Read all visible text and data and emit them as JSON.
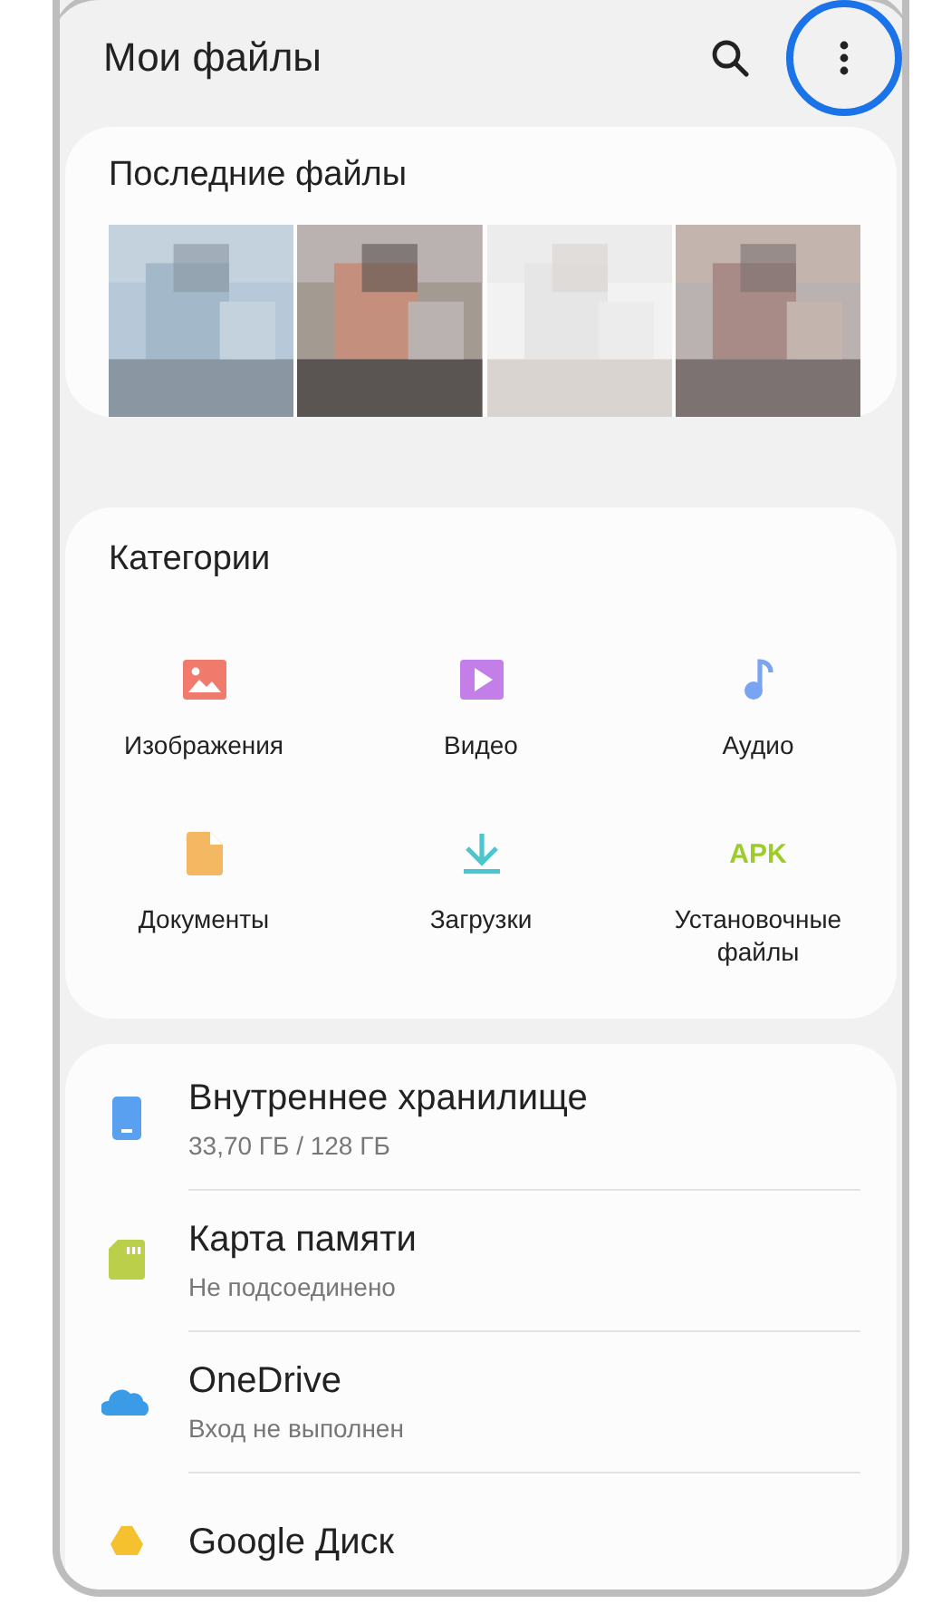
{
  "app_bar": {
    "title": "Мои файлы",
    "menu_highlighted": true
  },
  "recent": {
    "title": "Последние файлы"
  },
  "categories": {
    "title": "Категории",
    "items": [
      {
        "label": "Изображения",
        "kind": "images"
      },
      {
        "label": "Видео",
        "kind": "video"
      },
      {
        "label": "Аудио",
        "kind": "audio"
      },
      {
        "label": "Документы",
        "kind": "documents"
      },
      {
        "label": "Загрузки",
        "kind": "downloads"
      },
      {
        "label": "Установочные файлы",
        "kind": "apk",
        "icon_text": "APK"
      }
    ]
  },
  "storage": [
    {
      "name": "Внутреннее хранилище",
      "detail": "33,70 ГБ / 128 ГБ",
      "kind": "phone"
    },
    {
      "name": "Карта памяти",
      "detail": "Не подсоединено",
      "kind": "sdcard"
    },
    {
      "name": "OneDrive",
      "detail": "Вход не выполнен",
      "kind": "cloud"
    },
    {
      "name": "Google Диск",
      "kind": "drive"
    }
  ]
}
